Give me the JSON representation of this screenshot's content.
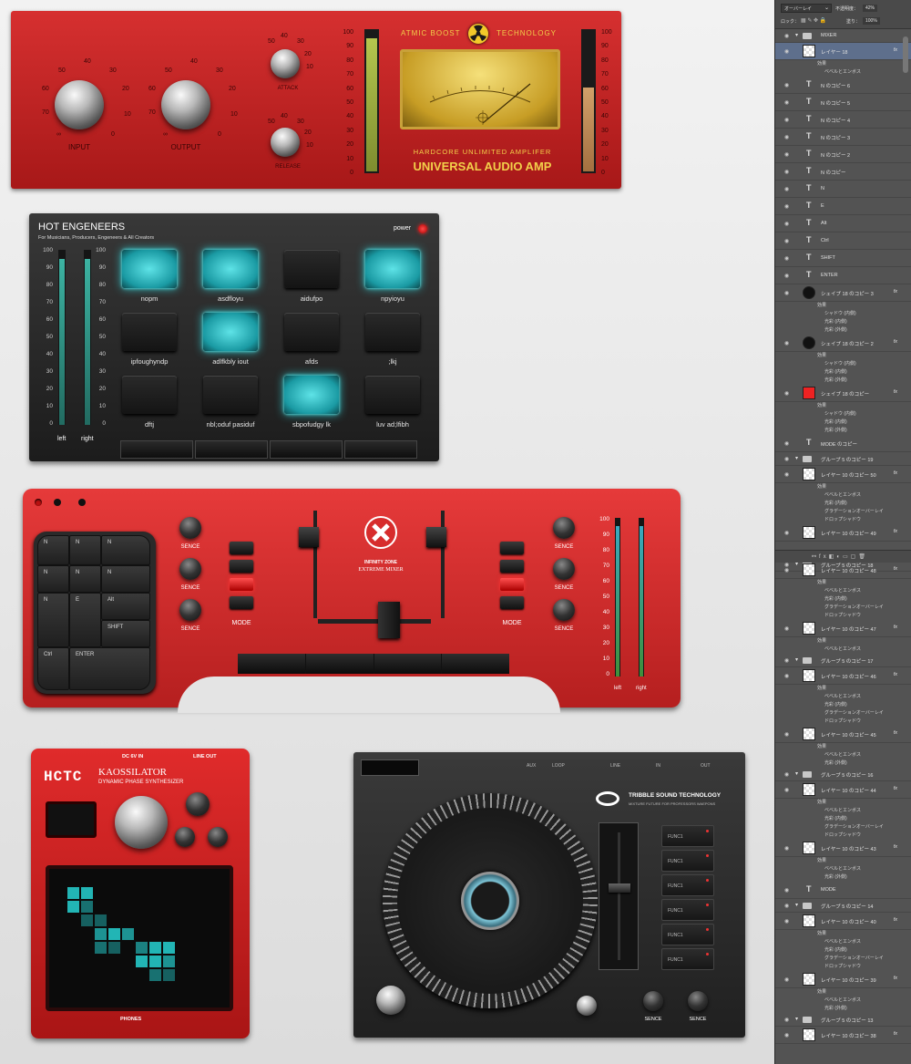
{
  "amp": {
    "brand_left": "ATMIC BOOST",
    "brand_right": "TECHNOLOGY",
    "subtitle": "HARDCORE UNLIMITED AMPLIFER",
    "title": "UNIVERSAL AUDIO AMP",
    "input_label": "INPUT",
    "output_label": "OUTPUT",
    "attack_label": "ATTACK",
    "release_label": "RELEASE",
    "ticks": [
      "60",
      "50",
      "40",
      "30",
      "20",
      "10",
      "0",
      "70",
      "∞"
    ],
    "small_ticks": [
      "40",
      "30",
      "20",
      "10",
      "0",
      "50",
      "∞"
    ],
    "scale": [
      "100",
      "90",
      "80",
      "70",
      "60",
      "50",
      "40",
      "30",
      "20",
      "10",
      "0"
    ],
    "left_level": 0.95,
    "right_level": 0.6,
    "colors": {
      "body": "#c82424",
      "meter": "#d9b43a",
      "bar": "#9aa94a"
    }
  },
  "pad": {
    "title": "HOT ENGENEERS",
    "subtitle": "For Musicians, Producers, Engeneers & All Creators",
    "power_label": "power",
    "scale": [
      "100",
      "90",
      "80",
      "70",
      "60",
      "50",
      "40",
      "30",
      "20",
      "10",
      "0"
    ],
    "left_label": "left",
    "right_label": "right",
    "left_level": 0.95,
    "right_level": 0.95,
    "buttons": [
      {
        "label": "nopm",
        "on": true
      },
      {
        "label": "asdfloyu",
        "on": true
      },
      {
        "label": "aidufpo",
        "on": false
      },
      {
        "label": "npyioyu",
        "on": true
      },
      {
        "label": "ipfoughyndp",
        "on": false
      },
      {
        "label": "adlfkbly iout",
        "on": true
      },
      {
        "label": "afds",
        "on": false
      },
      {
        "label": ";lkj",
        "on": false
      },
      {
        "label": "dftj",
        "on": false
      },
      {
        "label": "nbl;oduf pasiduf",
        "on": false
      },
      {
        "label": "sbpofudgy lk",
        "on": true
      },
      {
        "label": "luv  ad;lfibh",
        "on": false
      }
    ]
  },
  "mixer": {
    "keys": [
      "N",
      "N",
      "N",
      "N",
      "N",
      "N",
      "N",
      "E",
      "Alt",
      "SHIFT",
      "Ctrl",
      "ENTER"
    ],
    "sence_label": "SENCE",
    "mode_label": "MODE",
    "logo_top": "INFINITY ZONE",
    "logo_title": "EXTREME MIXER",
    "scale": [
      "100",
      "90",
      "80",
      "70",
      "60",
      "50",
      "40",
      "30",
      "20",
      "10",
      "0"
    ],
    "left_label": "left",
    "right_label": "right",
    "left_level": 0.95,
    "right_level": 0.95
  },
  "kaoss": {
    "logo": "HCTC",
    "name": "KAOSSILATOR",
    "subtitle": "DYNAMIC PHASE SYNTHESIZER",
    "dc_label": "DC 6V IN",
    "line_label": "LINE OUT",
    "phones_label": "PHONES"
  },
  "turntable": {
    "brand": "TRIBBLE SOUND TECHNOLOGY",
    "tagline": "MIXTURE FUTURE FOR PROFESSORS WAEPONS",
    "io": [
      "AUX",
      "LOOP",
      "LINE",
      "IN",
      "OUT"
    ],
    "func_label": "FUNC1",
    "sence_label": "SENCE",
    "pitch_level": 0.6
  },
  "panel": {
    "blend": "オーバーレイ",
    "opacity_label": "不透明度：",
    "opacity": "42%",
    "lock_label": "ロック：",
    "fill_label": "塗り：",
    "fill": "100%",
    "rows": [
      {
        "type": "group",
        "name": "MIXER"
      },
      {
        "type": "layer",
        "name": "レイヤー 18",
        "fx": true,
        "selected": true
      },
      {
        "type": "sub",
        "name": "効果"
      },
      {
        "type": "sub2",
        "name": "ベベルとエンボス"
      },
      {
        "type": "text",
        "name": "N のコピー 6"
      },
      {
        "type": "text",
        "name": "N のコピー 5"
      },
      {
        "type": "text",
        "name": "N のコピー 4"
      },
      {
        "type": "text",
        "name": "N のコピー 3"
      },
      {
        "type": "text",
        "name": "N のコピー 2"
      },
      {
        "type": "text",
        "name": "N のコピー"
      },
      {
        "type": "text",
        "name": "N"
      },
      {
        "type": "text",
        "name": "E"
      },
      {
        "type": "text",
        "name": "Alt"
      },
      {
        "type": "text",
        "name": "Ctrl"
      },
      {
        "type": "text",
        "name": "SHIFT"
      },
      {
        "type": "text",
        "name": "ENTER"
      },
      {
        "type": "shape",
        "name": "シェイプ 18 のコピー 3",
        "fx": true
      },
      {
        "type": "sub",
        "name": "効果"
      },
      {
        "type": "sub2",
        "name": "シャドウ (内側)"
      },
      {
        "type": "sub2",
        "name": "光彩 (内側)"
      },
      {
        "type": "sub2",
        "name": "光彩 (外側)"
      },
      {
        "type": "shape",
        "name": "シェイプ 18 のコピー 2",
        "fx": true
      },
      {
        "type": "sub",
        "name": "効果"
      },
      {
        "type": "sub2",
        "name": "シャドウ (内側)"
      },
      {
        "type": "sub2",
        "name": "光彩 (内側)"
      },
      {
        "type": "sub2",
        "name": "光彩 (外側)"
      },
      {
        "type": "shape-red",
        "name": "シェイプ 18 のコピー",
        "fx": true
      },
      {
        "type": "sub",
        "name": "効果"
      },
      {
        "type": "sub2",
        "name": "シャドウ (内側)"
      },
      {
        "type": "sub2",
        "name": "光彩 (内側)"
      },
      {
        "type": "sub2",
        "name": "光彩 (外側)"
      },
      {
        "type": "text",
        "name": "MODE のコピー"
      },
      {
        "type": "group",
        "name": "グループ 5 のコピー 19"
      },
      {
        "type": "layer",
        "name": "レイヤー 10 のコピー 50",
        "fx": true
      },
      {
        "type": "sub",
        "name": "効果"
      },
      {
        "type": "sub2",
        "name": "ベベルとエンボス"
      },
      {
        "type": "sub2",
        "name": "光彩 (内側)"
      },
      {
        "type": "sub2",
        "name": "グラデーションオーバーレイ"
      },
      {
        "type": "sub2",
        "name": "ドロップシャドウ"
      },
      {
        "type": "layer",
        "name": "レイヤー 10 のコピー 49",
        "fx": true
      },
      {
        "type": "gap"
      },
      {
        "type": "group",
        "name": "グループ 5 のコピー 18"
      },
      {
        "type": "layer",
        "name": "レイヤー 10 のコピー 48",
        "fx": true
      },
      {
        "type": "sub",
        "name": "効果"
      },
      {
        "type": "sub2",
        "name": "ベベルとエンボス"
      },
      {
        "type": "sub2",
        "name": "光彩 (内側)"
      },
      {
        "type": "sub2",
        "name": "グラデーションオーバーレイ"
      },
      {
        "type": "sub2",
        "name": "ドロップシャドウ"
      },
      {
        "type": "layer",
        "name": "レイヤー 10 のコピー 47",
        "fx": true
      },
      {
        "type": "sub",
        "name": "効果"
      },
      {
        "type": "sub2",
        "name": "ベベルとエンボス"
      },
      {
        "type": "group",
        "name": "グループ 5 のコピー 17"
      },
      {
        "type": "layer",
        "name": "レイヤー 10 のコピー 46",
        "fx": true
      },
      {
        "type": "sub",
        "name": "効果"
      },
      {
        "type": "sub2",
        "name": "ベベルとエンボス"
      },
      {
        "type": "sub2",
        "name": "光彩 (内側)"
      },
      {
        "type": "sub2",
        "name": "グラデーションオーバーレイ"
      },
      {
        "type": "sub2",
        "name": "ドロップシャドウ"
      },
      {
        "type": "layer",
        "name": "レイヤー 10 のコピー 45",
        "fx": true
      },
      {
        "type": "sub",
        "name": "効果"
      },
      {
        "type": "sub2",
        "name": "ベベルとエンボス"
      },
      {
        "type": "sub2",
        "name": "光彩 (外側)"
      },
      {
        "type": "group",
        "name": "グループ 5 のコピー 16"
      },
      {
        "type": "layer",
        "name": "レイヤー 10 のコピー 44",
        "fx": true
      },
      {
        "type": "sub",
        "name": "効果"
      },
      {
        "type": "sub2",
        "name": "ベベルとエンボス"
      },
      {
        "type": "sub2",
        "name": "光彩 (内側)"
      },
      {
        "type": "sub2",
        "name": "グラデーションオーバーレイ"
      },
      {
        "type": "sub2",
        "name": "ドロップシャドウ"
      },
      {
        "type": "layer",
        "name": "レイヤー 10 のコピー 43",
        "fx": true
      },
      {
        "type": "sub",
        "name": "効果"
      },
      {
        "type": "sub2",
        "name": "ベベルとエンボス"
      },
      {
        "type": "sub2",
        "name": "光彩 (外側)"
      },
      {
        "type": "text",
        "name": "MODE"
      },
      {
        "type": "group",
        "name": "グループ 5 のコピー 14"
      },
      {
        "type": "layer",
        "name": "レイヤー 10 のコピー 40",
        "fx": true
      },
      {
        "type": "sub",
        "name": "効果"
      },
      {
        "type": "sub2",
        "name": "ベベルとエンボス"
      },
      {
        "type": "sub2",
        "name": "光彩 (内側)"
      },
      {
        "type": "sub2",
        "name": "グラデーションオーバーレイ"
      },
      {
        "type": "sub2",
        "name": "ドロップシャドウ"
      },
      {
        "type": "layer",
        "name": "レイヤー 10 のコピー 39",
        "fx": true
      },
      {
        "type": "sub",
        "name": "効果"
      },
      {
        "type": "sub2",
        "name": "ベベルとエンボス"
      },
      {
        "type": "sub2",
        "name": "光彩 (外側)"
      },
      {
        "type": "group",
        "name": "グループ 5 のコピー 13"
      },
      {
        "type": "layer",
        "name": "レイヤー 10 のコピー 38",
        "fx": true
      }
    ]
  }
}
